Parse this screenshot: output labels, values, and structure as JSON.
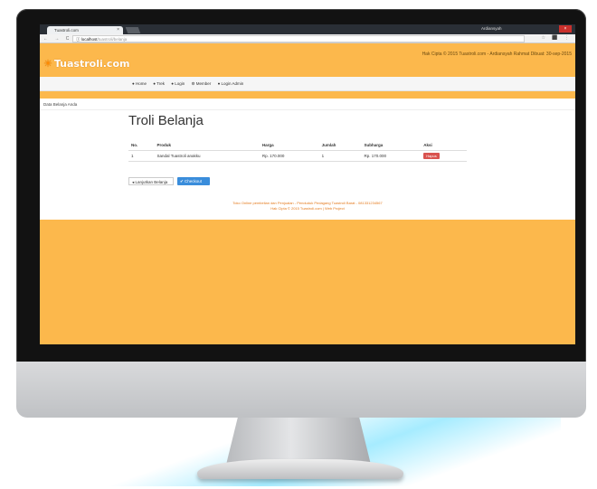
{
  "browser": {
    "tab_title": "Tuastroli.com",
    "tab_close": "×",
    "profile_name": "Ardiansyah",
    "window_close": "×",
    "nav_glyphs": "← → C",
    "url_host": "ⓘ localhost",
    "url_path": "/tuastroli/belanja",
    "ext_glyphs": "☆ ⬛ ⋮"
  },
  "site": {
    "logo_text": "Tuastroli.com",
    "meta_text": "Hak Cipta © 2015 Tuastroli.com - Ardiansyah Rahmat Dibuat: 30-sep-2015",
    "nav_items": [
      "● Home",
      "● Trek",
      "● Login",
      "⚙ Member",
      "● Login Admin"
    ],
    "breadcrumb": "Data Belanja Anda",
    "page_title": "Troli Belanja",
    "table": {
      "headers": [
        "No.",
        "Produk",
        "Harga",
        "Jumlah",
        "Subharga",
        "Aksi"
      ],
      "rows": [
        [
          "1",
          "Sandal Tuastroli anakku",
          "Rp. 170.000",
          "1",
          "Rp. 170.000",
          "Hapus"
        ]
      ]
    },
    "continue_button": "◂ Lanjutkan Belanja",
    "checkout_button": "✔ Checkout",
    "footer_line1": "Toko Online pembelian dan Penjualan - Penduduk Pedagang Tuastroli Barat - 081331234567",
    "footer_line2": "Hak Cipta © 2015 Tuastroli.com | Web Project"
  },
  "colors": {
    "accent": "#fcb84c",
    "checkout": "#3a8ddb",
    "delete": "#d9534f"
  }
}
